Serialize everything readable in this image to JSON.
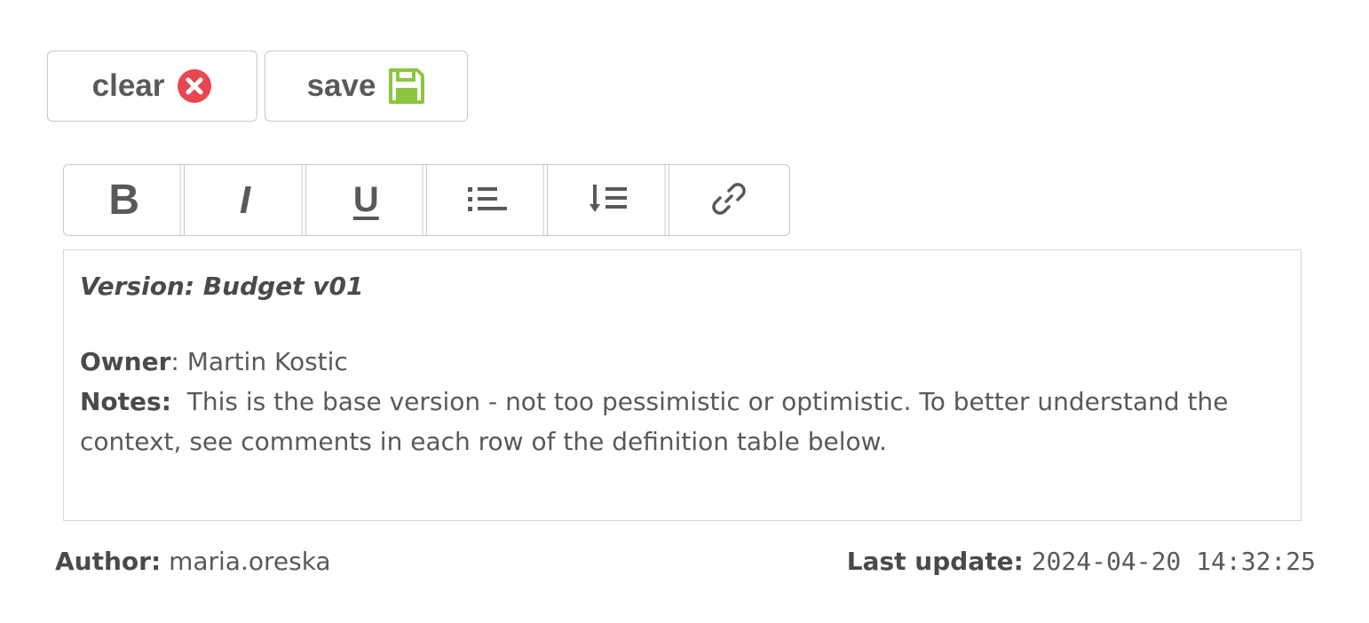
{
  "actions": {
    "clear": {
      "label": "clear",
      "icon": "clear-circle-x-icon",
      "icon_color": "#e8474f"
    },
    "save": {
      "label": "save",
      "icon": "floppy-disk-icon",
      "icon_color": "#8cc63f"
    }
  },
  "toolbar": {
    "bold": {
      "label": "B",
      "icon": "bold-icon"
    },
    "italic": {
      "label": "I",
      "icon": "italic-icon"
    },
    "underline": {
      "label": "U",
      "icon": "underline-icon"
    },
    "bullet_list": {
      "icon": "bullet-list-icon"
    },
    "ordered_list": {
      "icon": "sort-list-icon"
    },
    "link": {
      "icon": "link-icon"
    }
  },
  "editor": {
    "version_line": "Version: Budget v01",
    "owner_label": "Owner",
    "owner_value": ": Martin Kostic",
    "notes_label": "Notes:",
    "notes_value": "  This is the base version - not too pessimistic or optimistic. To better understand the context, see comments in each row of the definition table below."
  },
  "meta": {
    "author_label": "Author:",
    "author_value": "maria.oreska",
    "last_update_label": "Last update:",
    "last_update_value": "2024-04-20 14:32:25"
  },
  "colors": {
    "text": "#595959",
    "border": "#c8c8c8",
    "clear_icon": "#e8474f",
    "save_icon": "#8cc63f"
  }
}
